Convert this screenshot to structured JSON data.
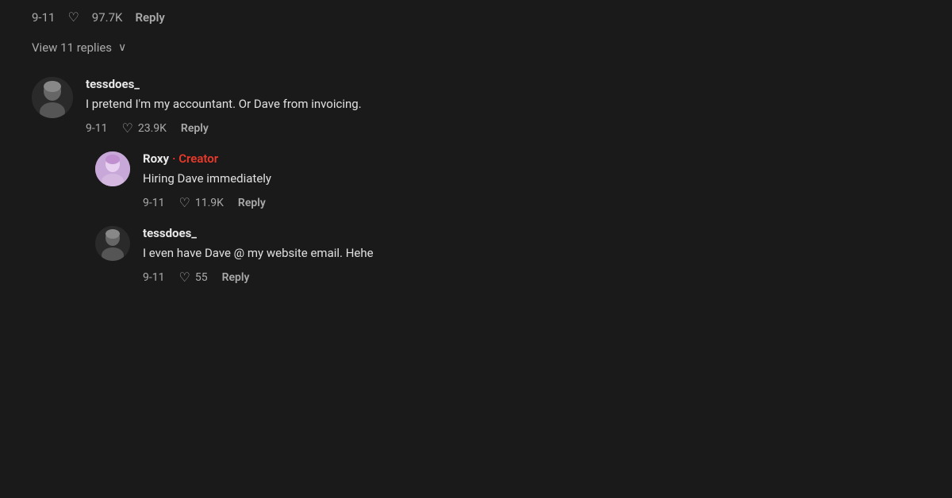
{
  "top_bar": {
    "date": "9-11",
    "likes": "97.7K",
    "reply_label": "Reply"
  },
  "view_replies": {
    "label": "View 11 replies",
    "chevron": "∨"
  },
  "comments": [
    {
      "id": "comment-1",
      "username": "tessdoes_",
      "is_creator": false,
      "creator_label": "",
      "text": "I pretend I'm my accountant. Or Dave from invoicing.",
      "date": "9-11",
      "likes": "23.9K",
      "reply_label": "Reply",
      "avatar_type": "tessdoes",
      "is_reply": false
    },
    {
      "id": "comment-2",
      "username": "Roxy",
      "is_creator": true,
      "creator_label": "· Creator",
      "text": "Hiring Dave immediately",
      "date": "9-11",
      "likes": "11.9K",
      "reply_label": "Reply",
      "avatar_type": "roxy",
      "is_reply": true
    },
    {
      "id": "comment-3",
      "username": "tessdoes_",
      "is_creator": false,
      "creator_label": "",
      "text": "I even have Dave @ my website email. Hehe",
      "date": "9-11",
      "likes": "55",
      "reply_label": "Reply",
      "avatar_type": "tessdoes2",
      "is_reply": true
    }
  ]
}
